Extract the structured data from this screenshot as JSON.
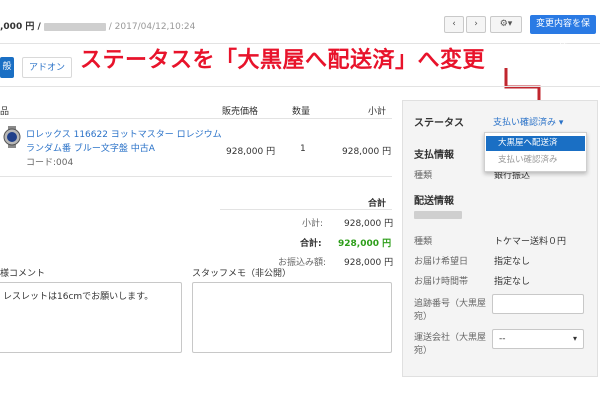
{
  "header": {
    "price_prefix": ",000 円 / ",
    "date": "/ 2017/04/12,10:24",
    "prev_icon": "chevron-left-icon",
    "next_icon": "chevron-right-icon",
    "gear_icon": "gear-icon",
    "save_label": "変更内容を保存"
  },
  "annotation": {
    "text": "ステータスを「大黒屋へ配送済」へ変更",
    "color": "#e8132b"
  },
  "tabs": [
    {
      "label": "般",
      "active": true
    },
    {
      "label": "アドオン",
      "active": false
    }
  ],
  "items_table": {
    "headers": {
      "item": "品",
      "price": "販売価格",
      "qty": "数量",
      "subtotal": "小計"
    },
    "rows": [
      {
        "name_line1": "ロレックス 116622 ヨットマスター ロレジウム",
        "name_line2": "ランダム番 ブルー文字盤 中古A",
        "code": "コード:004",
        "price": "928,000 円",
        "qty": "1",
        "subtotal": "928,000 円"
      }
    ]
  },
  "totals": {
    "heading": "合計",
    "subtotal_label": "小計:",
    "subtotal_value": "928,000 円",
    "total_label": "合計:",
    "total_value": "928,000 円",
    "total_color": "#2e9e1a",
    "paid_label": "お振込み額:",
    "paid_value": "928,000 円"
  },
  "comments": {
    "customer_label": "様コメント",
    "customer_text": "レスレットは16cmでお願いします。",
    "staff_label": "スタッフメモ（非公開）",
    "staff_text": ""
  },
  "side_panel": {
    "status_label": "ステータス",
    "status_value": "支払い確認済み",
    "payment_heading": "支払情報",
    "payment_type_label": "種類",
    "payment_type_value": "銀行振込",
    "shipping_heading": "配送情報",
    "shipping_type_label": "種類",
    "shipping_type_value": "トケマー送料０円",
    "delivery_date_label": "お届け希望日",
    "delivery_date_value": "指定なし",
    "delivery_time_label": "お届け時間帯",
    "delivery_time_value": "指定なし",
    "tracking_label_line1": "追跡番号（大黒屋",
    "tracking_label_line2": "宛）",
    "tracking_value": "",
    "carrier_label_line1": "運送会社（大黒屋",
    "carrier_label_line2": "宛）",
    "carrier_value": "--"
  },
  "status_dropdown": {
    "options": [
      {
        "label": "大黒屋へ配送済",
        "selected": true
      },
      {
        "label": "支払い確認済み",
        "selected": false
      }
    ]
  }
}
